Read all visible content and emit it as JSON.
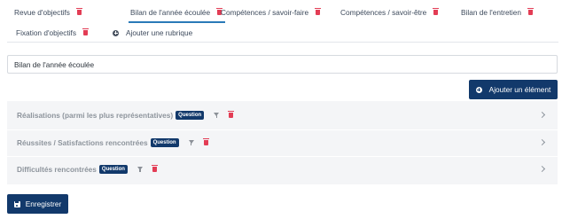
{
  "tabs": [
    {
      "label": "Revue d'objectifs",
      "active": false
    },
    {
      "label": "Bilan de l'année écoulée",
      "active": true
    },
    {
      "label": "Compétences / savoir-faire",
      "active": false
    },
    {
      "label": "Compétences / savoir-être",
      "active": false
    },
    {
      "label": "Bilan de l'entretien",
      "active": false
    },
    {
      "label": "Fixation d'objectifs",
      "active": false
    }
  ],
  "add_rubrique_label": "Ajouter une rubrique",
  "section_title_value": "Bilan de l'année écoulée",
  "add_element_label": "Ajouter un élément",
  "questions": [
    {
      "label": "Réalisations (parmi les plus représentatives)",
      "badge": "Question"
    },
    {
      "label": "Réussites / Satisfactions rencontrées",
      "badge": "Question"
    },
    {
      "label": "Difficultés rencontrées",
      "badge": "Question"
    }
  ],
  "save_label": "Enregistrer",
  "colors": {
    "primary": "#12396b",
    "active_tab_underline": "#2a7ab8",
    "delete": "#e33d55",
    "panel_bg": "#f4f5f7"
  },
  "icons": {
    "delete": "trash-icon",
    "filter": "filter-icon",
    "add": "plus-circle-icon",
    "expand": "chevron-right-icon",
    "save": "floppy-disk-icon"
  }
}
